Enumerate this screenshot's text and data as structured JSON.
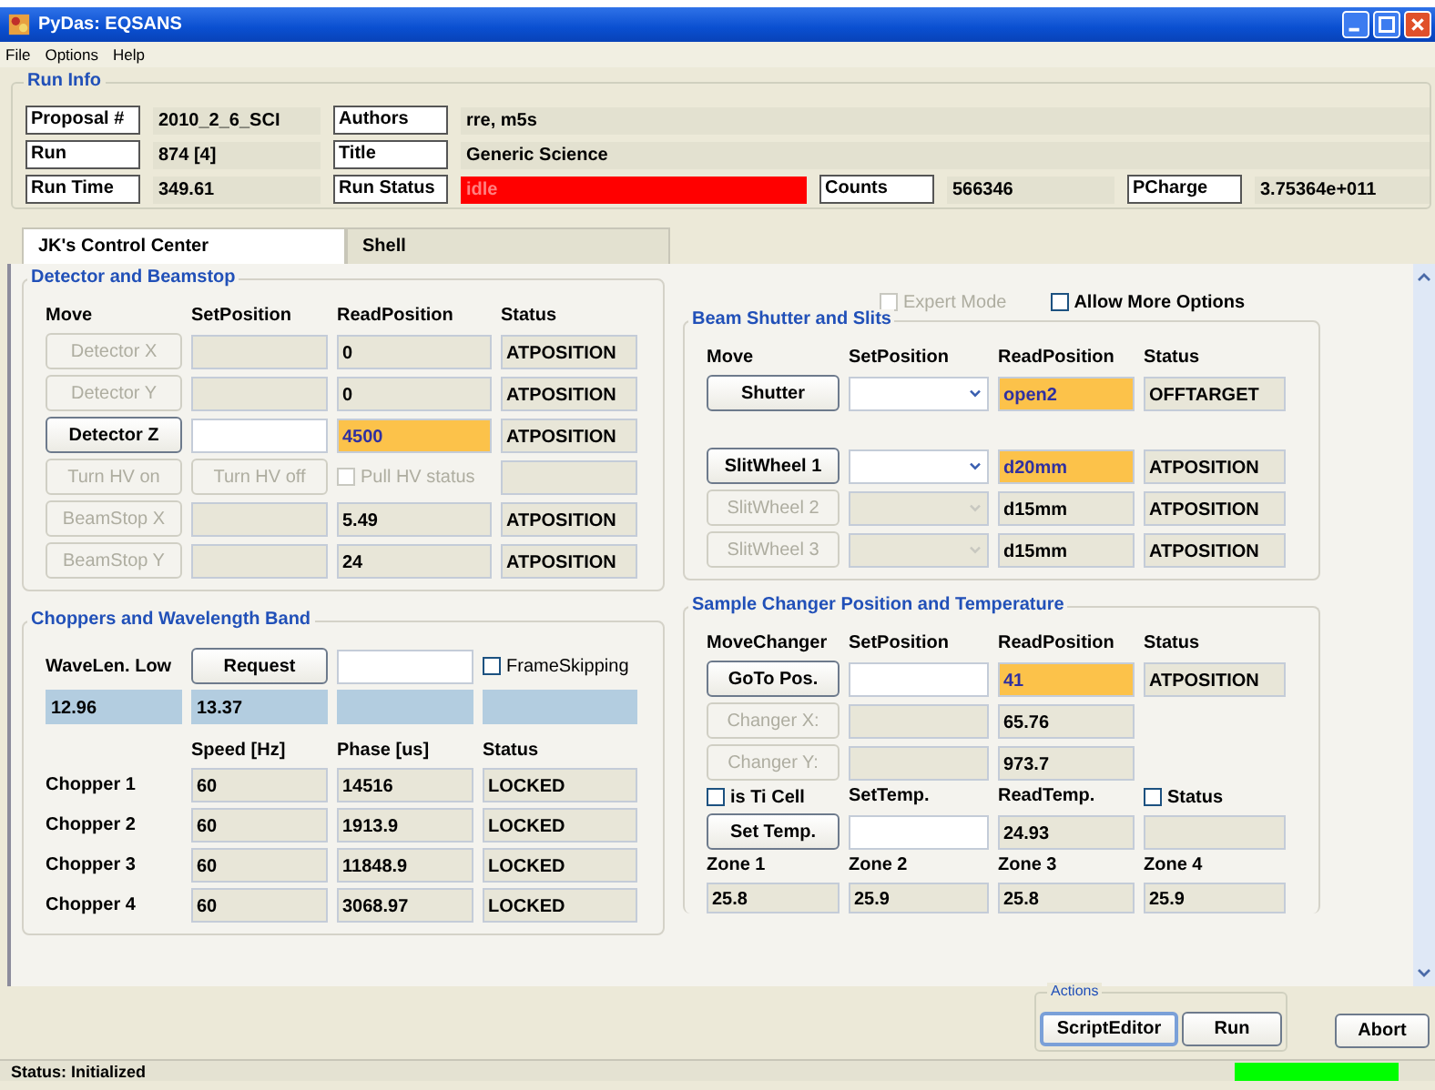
{
  "window": {
    "title": "PyDas: EQSANS"
  },
  "menu": [
    "File",
    "Options",
    "Help"
  ],
  "run_info": {
    "title": "Run Info",
    "rows": [
      [
        {
          "label": "Proposal #",
          "value": "2010_2_6_SCI",
          "kind": "text"
        },
        {
          "label": "Authors",
          "value": "rre, m5s",
          "kind": "text"
        }
      ],
      [
        {
          "label": "Run",
          "value": "874 [4]",
          "kind": "text"
        },
        {
          "label": "Title",
          "value": "Generic Science",
          "kind": "text"
        }
      ],
      [
        {
          "label": "Run Time",
          "value": "349.61",
          "kind": "text"
        },
        {
          "label": "Run Status",
          "value": "idle",
          "kind": "alarm"
        },
        {
          "label": "Counts",
          "value": "566346",
          "kind": "text"
        },
        {
          "label": "PCharge",
          "value": "3.75364e+011",
          "kind": "text"
        }
      ]
    ]
  },
  "tabs": [
    {
      "label": "JK's Control Center",
      "selected": true
    },
    {
      "label": "Shell",
      "selected": false
    }
  ],
  "options": [
    {
      "label": "Expert Mode",
      "checked": false,
      "disabled": true
    },
    {
      "label": "Allow More Options",
      "checked": false,
      "disabled": false
    }
  ],
  "detector": {
    "title": "Detector and Beamstop",
    "columns": [
      "Move",
      "SetPosition",
      "ReadPosition",
      "Status"
    ],
    "rows": [
      {
        "kind": "motor",
        "button": "Detector X",
        "enabled": false,
        "read": "0",
        "highlighted": false,
        "status": "ATPOSITION"
      },
      {
        "kind": "motor",
        "button": "Detector Y",
        "enabled": false,
        "read": "0",
        "highlighted": false,
        "status": "ATPOSITION"
      },
      {
        "kind": "motor",
        "button": "Detector Z",
        "enabled": true,
        "read": "4500",
        "highlighted": true,
        "status": "ATPOSITION"
      },
      {
        "kind": "hv",
        "buttons": [
          {
            "label": "Turn HV on",
            "enabled": false
          },
          {
            "label": "Turn HV off",
            "enabled": false
          }
        ],
        "checkbox": {
          "label": "Pull HV status",
          "checked": false,
          "disabled": true
        }
      },
      {
        "kind": "motor",
        "button": "BeamStop X",
        "enabled": false,
        "read": "5.49",
        "highlighted": false,
        "status": "ATPOSITION"
      },
      {
        "kind": "motor",
        "button": "BeamStop Y",
        "enabled": false,
        "read": "24",
        "highlighted": false,
        "status": "ATPOSITION"
      }
    ]
  },
  "beam": {
    "title": "Beam Shutter and Slits",
    "columns": [
      "Move",
      "SetPosition",
      "ReadPosition",
      "Status"
    ],
    "groups": [
      [
        {
          "button": "Shutter",
          "enabled": true,
          "read": "open2",
          "highlighted": true,
          "status": "OFFTARGET"
        }
      ],
      [
        {
          "button": "SlitWheel 1",
          "enabled": true,
          "read": "d20mm",
          "highlighted": true,
          "status": "ATPOSITION"
        },
        {
          "button": "SlitWheel 2",
          "enabled": false,
          "read": "d15mm",
          "highlighted": false,
          "status": "ATPOSITION"
        },
        {
          "button": "SlitWheel 3",
          "enabled": false,
          "read": "d15mm",
          "highlighted": false,
          "status": "ATPOSITION"
        }
      ]
    ]
  },
  "choppers": {
    "title": "Choppers and Wavelength Band",
    "wavelength": {
      "label": "WaveLen. Low",
      "button": "Request",
      "frame_skipping": {
        "label": "FrameSkipping",
        "checked": false
      },
      "values": [
        "12.96",
        "13.37"
      ]
    },
    "columns": [
      "Speed [Hz]",
      "Phase [us]",
      "Status"
    ],
    "rows": [
      {
        "name": "Chopper 1",
        "speed": "60",
        "phase": "14516",
        "status": "LOCKED"
      },
      {
        "name": "Chopper 2",
        "speed": "60",
        "phase": "1913.9",
        "status": "LOCKED"
      },
      {
        "name": "Chopper 3",
        "speed": "60",
        "phase": "11848.9",
        "status": "LOCKED"
      },
      {
        "name": "Chopper 4",
        "speed": "60",
        "phase": "3068.97",
        "status": "LOCKED"
      }
    ]
  },
  "sample": {
    "title": "Sample Changer Position and Temperature",
    "columns": [
      "MoveChanger",
      "SetPosition",
      "ReadPosition",
      "Status"
    ],
    "rows": [
      {
        "button": "GoTo Pos.",
        "enabled": true,
        "read": "41",
        "highlighted": true,
        "status": "ATPOSITION"
      },
      {
        "button": "Changer X:",
        "enabled": false,
        "read": "65.76",
        "highlighted": false
      },
      {
        "button": "Changer Y:",
        "enabled": false,
        "read": "973.7",
        "highlighted": false
      }
    ],
    "temperature": {
      "ti_cell": {
        "label": "is Ti Cell",
        "checked": false
      },
      "set_label": "SetTemp.",
      "read_label": "ReadTemp.",
      "status_check": {
        "label": "Status",
        "checked": false
      },
      "button": "Set Temp.",
      "read": "24.93"
    },
    "zones": [
      {
        "label": "Zone 1",
        "value": "25.8"
      },
      {
        "label": "Zone 2",
        "value": "25.9"
      },
      {
        "label": "Zone 3",
        "value": "25.8"
      },
      {
        "label": "Zone 4",
        "value": "25.9"
      }
    ]
  },
  "actions": {
    "title": "Actions",
    "buttons": [
      "ScriptEditor",
      "Run"
    ],
    "abort": "Abort"
  },
  "status_bar": {
    "text": "Status: Initialized"
  }
}
